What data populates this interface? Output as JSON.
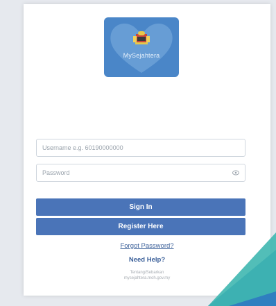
{
  "app": {
    "logo_text": "MySejahtera"
  },
  "form": {
    "username_placeholder": "Username e.g. 60190000000",
    "password_placeholder": "Password",
    "show_password_icon": "eye-icon"
  },
  "buttons": {
    "sign_in": "Sign In",
    "register": "Register Here"
  },
  "links": {
    "forgot_password": "Forgot Password?",
    "need_help": "Need Help?"
  },
  "footer": {
    "line1": "Tentang/Sebarkan",
    "line2": "mysejahtera.moh.gov.my"
  },
  "colors": {
    "logo_bg": "#4a86c8",
    "button_bg": "#4a74b8",
    "link": "#3a5f99",
    "corner_teal": "#3fb7b0",
    "corner_blue": "#2f7fc0"
  }
}
